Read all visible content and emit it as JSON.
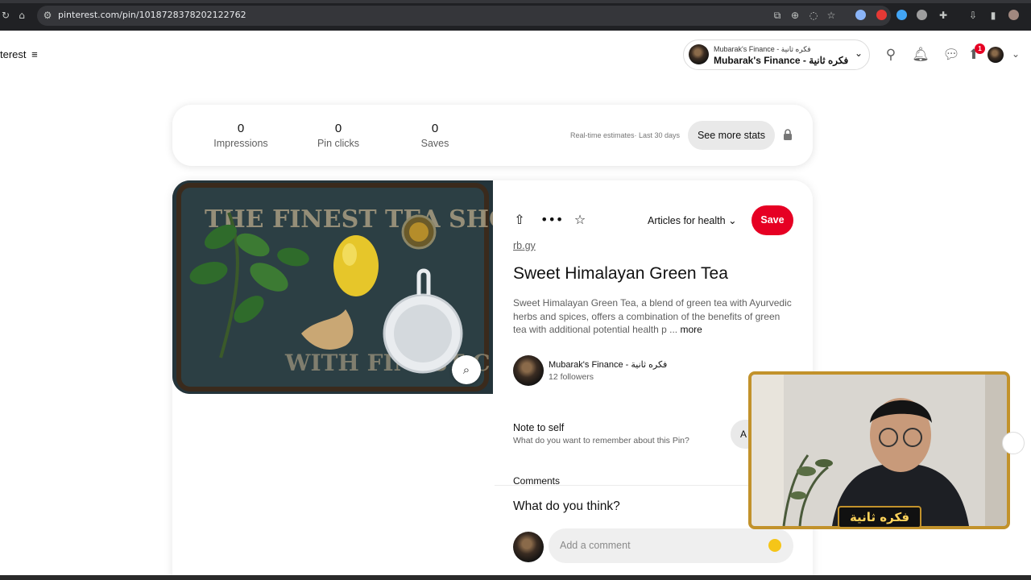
{
  "browser": {
    "url": "pinterest.com/pin/1018728378202122762"
  },
  "header": {
    "brand_partial": "terest",
    "menu_icon": "menu-icon",
    "account": {
      "name_small": "Mubarak's Finance - فكره ثانية",
      "name_large": "Mubarak's Finance - فكره ثانية"
    },
    "notifications_badge": "1"
  },
  "stats": {
    "items": [
      {
        "value": "0",
        "label": "Impressions"
      },
      {
        "value": "0",
        "label": "Pin clicks"
      },
      {
        "value": "0",
        "label": "Saves"
      }
    ],
    "estimate_note": "Real-time estimates· Last 30 days",
    "see_more_label": "See more stats"
  },
  "pin": {
    "board_label": "Articles for health",
    "save_label": "Save",
    "link": "rb.gy",
    "title": "Sweet Himalayan Green Tea",
    "description": "Sweet Himalayan Green Tea, a blend of green tea with Ayurvedic herbs and spices, offers a combination of the benefits of green tea with additional potential health p ...",
    "more_label": "more",
    "image_sign_text": "THE FINEST TEA SHOP",
    "image_sign_text_bottom": "WITH FINEST C"
  },
  "creator": {
    "name": "Mubarak's Finance - فكره ثانية",
    "followers": "12 followers"
  },
  "note": {
    "title": "Note to self",
    "subtitle": "What do you want to remember about this Pin?",
    "button_partial": "A"
  },
  "comments": {
    "section_label": "Comments",
    "prompt": "What do you think?",
    "input_placeholder": "Add a comment"
  },
  "webcam": {
    "label": "فكره ثانية"
  },
  "colors": {
    "save_red": "#e60023",
    "cam_frame_gold": "#c2922b"
  }
}
